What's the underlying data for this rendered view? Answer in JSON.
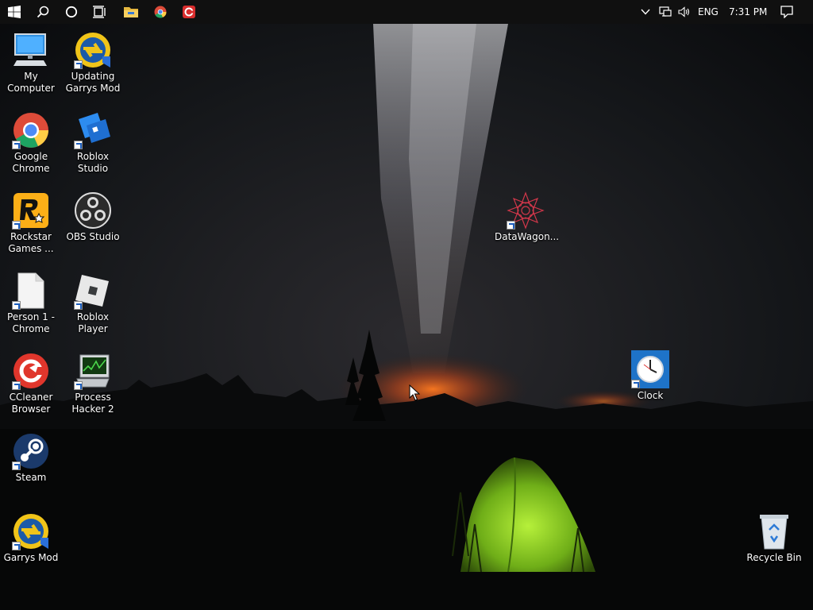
{
  "taskbar": {
    "pinned": [
      {
        "name": "start-button-icon"
      },
      {
        "name": "search-icon"
      },
      {
        "name": "cortana-icon"
      },
      {
        "name": "task-view-icon"
      },
      {
        "name": "file-explorer-icon"
      },
      {
        "name": "chrome-icon"
      },
      {
        "name": "ccleaner-browser-icon"
      }
    ],
    "tray": {
      "language": "ENG",
      "time": "7:31 PM"
    }
  },
  "desktop": {
    "icons": [
      {
        "label": "My Computer",
        "icon": "computer-icon"
      },
      {
        "label": "Updating\nGarrys Mod",
        "icon": "garrys-mod-icon"
      },
      {
        "label": "Google\nChrome",
        "icon": "chrome-icon"
      },
      {
        "label": "Roblox Studio",
        "icon": "roblox-studio-icon"
      },
      {
        "label": "Rockstar\nGames ...",
        "icon": "rockstar-icon"
      },
      {
        "label": "OBS Studio",
        "icon": "obs-icon"
      },
      {
        "label": "Person 1 -\nChrome",
        "icon": "document-icon"
      },
      {
        "label": "Roblox Player",
        "icon": "roblox-player-icon"
      },
      {
        "label": "CCleaner\nBrowser",
        "icon": "ccleaner-icon"
      },
      {
        "label": "Process\nHacker 2",
        "icon": "process-hacker-icon"
      },
      {
        "label": "Steam",
        "icon": "steam-icon"
      },
      {
        "label": "Garrys Mod",
        "icon": "garrys-mod-icon"
      },
      {
        "label": "DataWagon...",
        "icon": "datawagon-icon"
      },
      {
        "label": "Clock",
        "icon": "clock-icon"
      },
      {
        "label": "Recycle Bin",
        "icon": "recycle-bin-icon"
      }
    ]
  },
  "colors": {
    "taskbar": "#101010",
    "tent": "#8fd02a",
    "glow": "#e0641c"
  }
}
